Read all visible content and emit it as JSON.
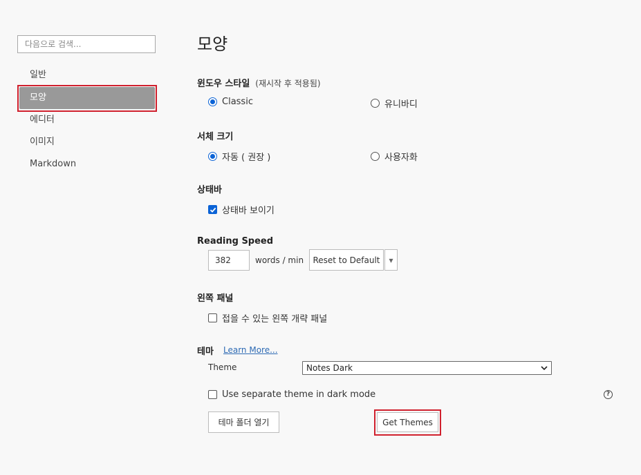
{
  "sidebar": {
    "search_placeholder": "다음으로 검색...",
    "items": [
      {
        "label": "일반"
      },
      {
        "label": "모양",
        "active": true
      },
      {
        "label": "에디터"
      },
      {
        "label": "이미지"
      },
      {
        "label": "Markdown"
      }
    ]
  },
  "main": {
    "title": "모양",
    "window_style": {
      "label": "윈도우 스타일",
      "note": "(재시작 후 적용됨)",
      "options": [
        {
          "label": "Classic",
          "checked": true
        },
        {
          "label": "유니바디",
          "checked": false
        }
      ]
    },
    "font_size": {
      "label": "서체 크기",
      "options": [
        {
          "label": "자동 ( 권장 )",
          "checked": true
        },
        {
          "label": "사용자화",
          "checked": false
        }
      ]
    },
    "status_bar": {
      "label": "상태바",
      "checkbox_label": "상태바 보이기",
      "checked": true
    },
    "reading_speed": {
      "label": "Reading Speed",
      "value": "382",
      "unit": "words / min",
      "reset_label": "Reset to Default",
      "dropdown_arrow": "▾"
    },
    "left_panel": {
      "label": "왼쪽 패널",
      "checkbox_label": "접을 수 있는 왼쪽 개략 패널",
      "checked": false
    },
    "theme": {
      "label": "테마",
      "learn_more": "Learn More...",
      "theme_label": "Theme",
      "selected": "Notes Dark",
      "dark_mode_label": "Use separate theme in dark mode",
      "dark_mode_checked": false,
      "help": "?",
      "open_folder_label": "테마 폴더 열기",
      "get_themes_label": "Get Themes"
    }
  },
  "colors": {
    "accent": "#0b63d6",
    "highlight_box": "#d0202d",
    "active_item_bg": "#999999"
  }
}
